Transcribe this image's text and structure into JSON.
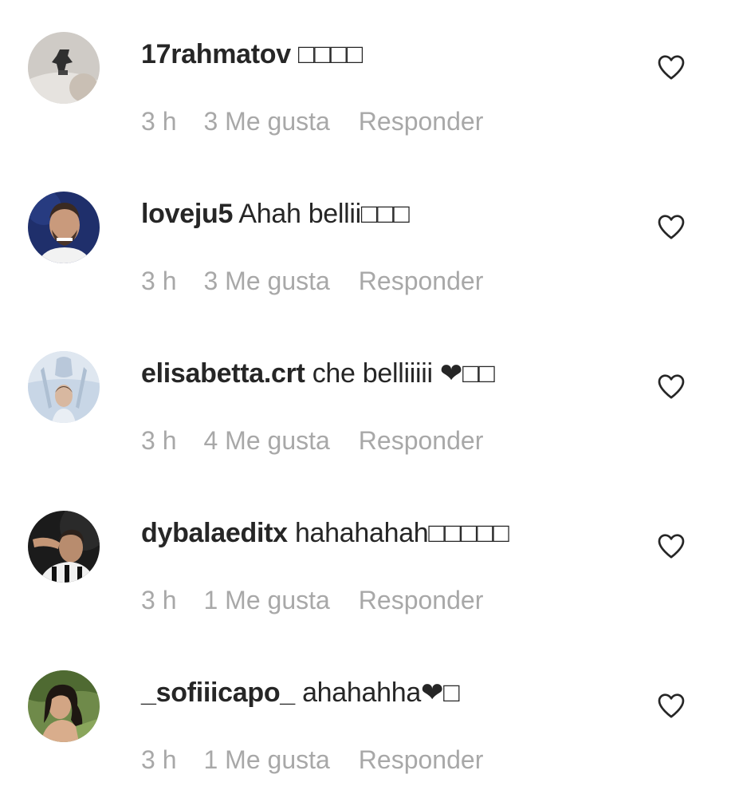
{
  "comments": [
    {
      "username": "17rahmatov",
      "text": "□□□□",
      "time": "3 h",
      "likes": "3 Me gusta",
      "reply": "Responder"
    },
    {
      "username": "loveju5",
      "text": "Ahah bellii□□□",
      "time": "3 h",
      "likes": "3 Me gusta",
      "reply": "Responder"
    },
    {
      "username": "elisabetta.crt",
      "text": "che belliiiii ❤□□",
      "time": "3 h",
      "likes": "4 Me gusta",
      "reply": "Responder"
    },
    {
      "username": "dybalaeditx",
      "text": "hahahahah□□□□□",
      "time": "3 h",
      "likes": "1 Me gusta",
      "reply": "Responder"
    },
    {
      "username": "_sofiiicapo_",
      "text": "ahahahha❤□",
      "time": "3 h",
      "likes": "1 Me gusta",
      "reply": "Responder"
    }
  ],
  "icons": {
    "like": "heart-outline-icon"
  },
  "colors": {
    "text": "#262626",
    "meta": "#a8a8a8"
  }
}
